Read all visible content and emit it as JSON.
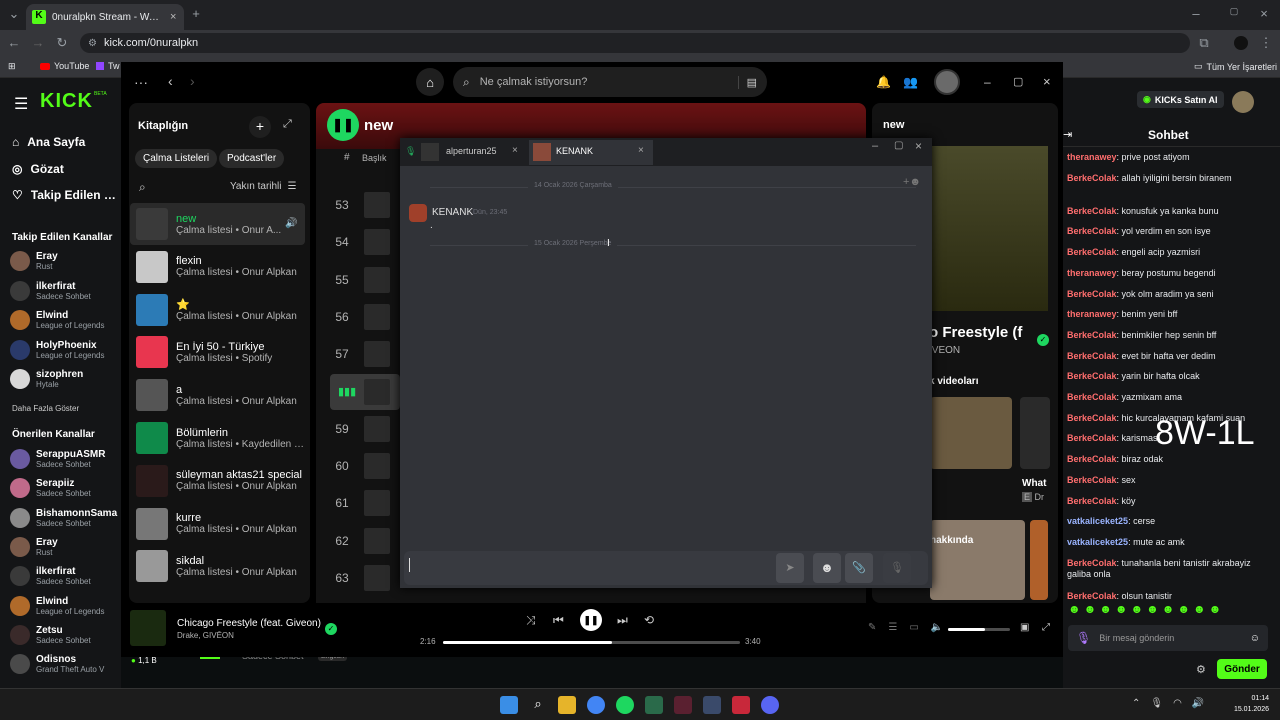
{
  "browser": {
    "tab_title": "0nuralpkn Stream - Watch Live",
    "url": "kick.com/0nuralpkn",
    "bookmarks": [
      "YouTube",
      "Tw"
    ],
    "all_bookmarks": "Tüm Yer İşaretleri"
  },
  "kick_left": {
    "logo": "KICK",
    "beta": "BETA",
    "nav": [
      "Ana Sayfa",
      "Gözat",
      "Takip Edilen Kan"
    ],
    "following_title": "Takip Edilen Kanallar",
    "following": [
      {
        "name": "Eray",
        "sub": "Rust"
      },
      {
        "name": "ilkerfirat",
        "sub": "Sadece Sohbet"
      },
      {
        "name": "Elwind",
        "sub": "League of Legends"
      },
      {
        "name": "HolyPhoenix",
        "sub": "League of Legends"
      },
      {
        "name": "sizophren",
        "sub": "Hytale"
      }
    ],
    "show_more": "Daha Fazla Göster",
    "recommended_title": "Önerilen Kanallar",
    "recommended": [
      {
        "name": "SerappuASMR",
        "sub": "Sadece Sohbet"
      },
      {
        "name": "Serapiiz",
        "sub": "Sadece Sohbet"
      },
      {
        "name": "BishamonnSama",
        "sub": "Sadece Sohbet"
      },
      {
        "name": "Eray",
        "sub": "Rust"
      },
      {
        "name": "ilkerfirat",
        "sub": "Sadece Sohbet"
      },
      {
        "name": "Elwind",
        "sub": "League of Legends"
      },
      {
        "name": "Zetsu",
        "sub": "Sadece Sohbet"
      },
      {
        "name": "Odisnos",
        "sub": "Grand Theft Auto V",
        "viewers": "1,1 B"
      }
    ],
    "bottom_cat": "Sadece Sohbet",
    "bottom_lang": "English"
  },
  "kick_right": {
    "buy": "KICKs Satın Al",
    "chat_title": "Sohbet",
    "overlay": "8W-1L",
    "messages": [
      {
        "user": "theranawey",
        "text": ": prive post atiyom",
        "c": "u1"
      },
      {
        "user": "BerkeColak",
        "text": ": allah iyiligini bersin biranem",
        "c": "u1"
      },
      {
        "user": "BerkeColak",
        "text": ": konusfuk ya kanka bunu",
        "c": "u1"
      },
      {
        "user": "BerkeColak",
        "text": ": yol verdim en son isye",
        "c": "u1"
      },
      {
        "user": "BerkeColak",
        "text": ": engeli acip yazmisri",
        "c": "u1"
      },
      {
        "user": "theranawey",
        "text": ": beray postumu begendi",
        "c": "u1"
      },
      {
        "user": "BerkeColak",
        "text": ": yok olm aradim ya seni",
        "c": "u1"
      },
      {
        "user": "theranawey",
        "text": ": benim yeni bff",
        "c": "u1"
      },
      {
        "user": "BerkeColak",
        "text": ": benimkiler hep senin bff",
        "c": "u1"
      },
      {
        "user": "BerkeColak",
        "text": ": evet bir hafta ver dedim",
        "c": "u1"
      },
      {
        "user": "BerkeColak",
        "text": ": yarin bir hafta olcak",
        "c": "u1"
      },
      {
        "user": "BerkeColak",
        "text": ": yazmixam ama",
        "c": "u1"
      },
      {
        "user": "BerkeColak",
        "text": ": hic kurcalayamam kafami suan",
        "c": "u1"
      },
      {
        "user": "BerkeColak",
        "text": ": karismas",
        "c": "u1"
      },
      {
        "user": "BerkeColak",
        "text": ": biraz odak",
        "c": "u1"
      },
      {
        "user": "BerkeColak",
        "text": ": sex",
        "c": "u1"
      },
      {
        "user": "BerkeColak",
        "text": ": köy",
        "c": "u1"
      },
      {
        "user": "vatkaliceket25",
        "text": ": cerse",
        "c": "u2"
      },
      {
        "user": "vatkaliceket25",
        "text": ": mute ac amk",
        "c": "u2"
      },
      {
        "user": "BerkeColak",
        "text": ": tunahanla beni tanistir akrabayiz galiba onla",
        "c": "u1"
      },
      {
        "user": "BerkeColak",
        "text": ": olsun tanistir",
        "c": "u1"
      }
    ],
    "input_placeholder": "Bir mesaj gönderin",
    "send": "Gönder"
  },
  "spotify": {
    "search_placeholder": "Ne çalmak istiyorsun?",
    "library": "Kitaplığın",
    "filter_playlists": "Çalma Listeleri",
    "filter_podcasts": "Podcast'ler",
    "sort": "Yakın tarihli",
    "items": [
      {
        "t": "new",
        "s": "Çalma listesi • Onur A...",
        "c": "#3a3a3a"
      },
      {
        "t": "flexin",
        "s": "Çalma listesi • Onur Alpkan",
        "c": "#c8c8c8"
      },
      {
        "t": "⭐",
        "s": "Çalma listesi • Onur Alpkan",
        "c": "#2c7bb6"
      },
      {
        "t": "En İyi 50 - Türkiye",
        "s": "Çalma listesi • Spotify",
        "c": "#e8364f"
      },
      {
        "t": "a",
        "s": "Çalma listesi • Onur Alpkan",
        "c": "#555"
      },
      {
        "t": "Bölümlerin",
        "s": "Çalma listesi • Kaydedilen v...",
        "c": "#0f8a4a"
      },
      {
        "t": "süleyman aktas21 special",
        "s": "Çalma listesi • Onur Alpkan",
        "c": "#2a1a1a"
      },
      {
        "t": "kurre",
        "s": "Çalma listesi • Onur Alpkan",
        "c": "#777"
      },
      {
        "t": "sikdal",
        "s": "Çalma listesi • Onur Alpkan",
        "c": "#999"
      }
    ],
    "playlist_title": "new",
    "col_title": "Başlık",
    "rows": [
      "53",
      "54",
      "55",
      "56",
      "57",
      "",
      "59",
      "60",
      "61",
      "62",
      "63"
    ],
    "np_label": "new",
    "np_song_partial": "o Freestyle (f",
    "np_artist_partial": "IVEON",
    "np_videos": "k videoları",
    "np_about": "hakkında",
    "np_what": "What",
    "np_dr": "Dr",
    "now_title": "Chicago Freestyle (feat. Giveon)",
    "now_artist": "Drake, GIVĒON",
    "elapsed": "2:16",
    "total": "3:40",
    "progress": 0.57,
    "volume": 0.6
  },
  "discord": {
    "tabs": [
      "alperturan25",
      "KENANK"
    ],
    "date1": "14 Ocak 2026 Çarşamba",
    "author": "KENANK",
    "time": "Dün, 23:45",
    "body": ".",
    "date2": "15 Ocak 2026 Perşembe"
  },
  "taskbar": {
    "time": "01:14",
    "date": "15.01.2026"
  }
}
